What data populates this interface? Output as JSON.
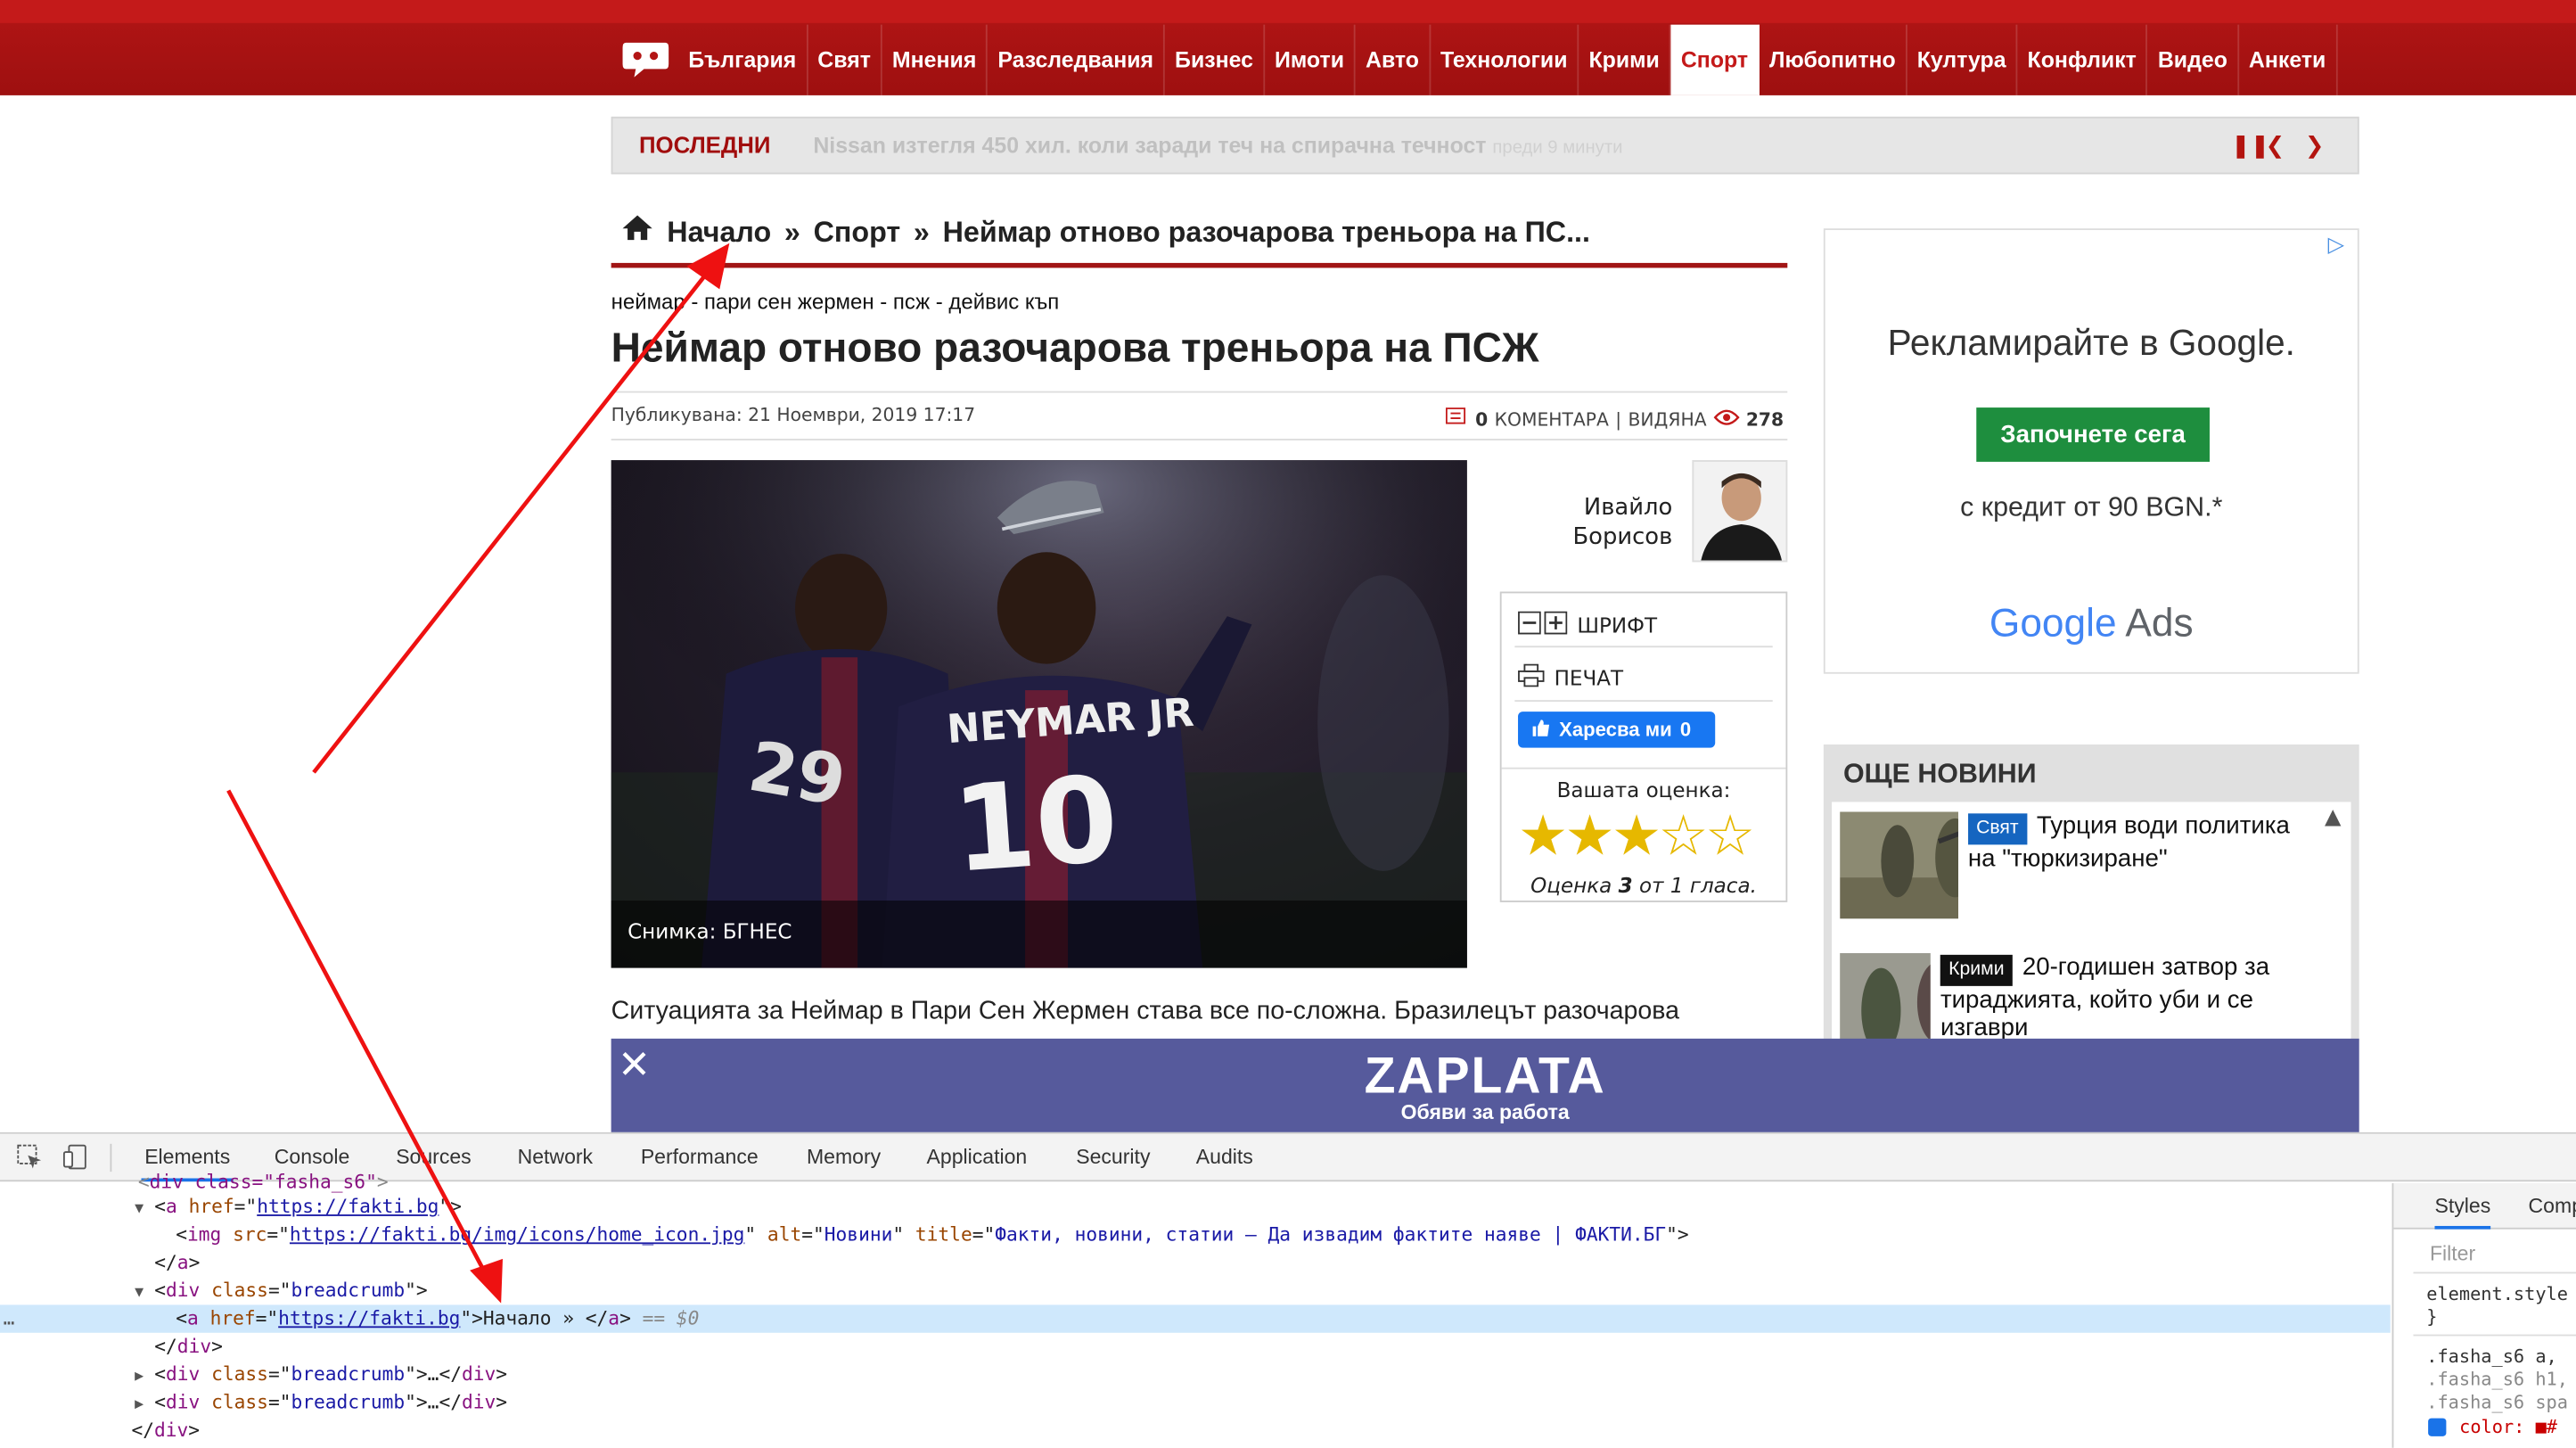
{
  "nav": {
    "items": [
      "България",
      "Свят",
      "Мнения",
      "Разследвания",
      "Бизнес",
      "Имоти",
      "Авто",
      "Технологии",
      "Крими",
      "Спорт",
      "Любопитно",
      "Култура",
      "Конфликт",
      "Видео",
      "Анкети"
    ],
    "active": "Спорт"
  },
  "ticker": {
    "label": "ПОСЛЕДНИ",
    "headline": "Nissan изтегля 450 хил. коли заради теч на спирачна течност",
    "time": "преди 9 минути"
  },
  "breadcrumb": {
    "home": "Начало",
    "sep1": "»",
    "section": "Спорт",
    "sep2": "»",
    "current": "Неймар отново разочарова треньора на ПС..."
  },
  "article": {
    "tags": "неймар - пари сен жермен - псж - дейвис къп",
    "title": "Неймар отново разочарова треньора на ПСЖ",
    "published": "Публикувана: 21 Ноември, 2019 17:17",
    "comments_count": "0",
    "comments_label": "КОМЕНТАРА",
    "views_label": "ВИДЯНА",
    "views_count": "278",
    "photo_caption": "Снимка: БГНЕС",
    "jersey_name": "NEYMAR JR",
    "jersey_number": "10",
    "lead": "Ситуацията за Неймар в Пари Сен Жермен става все по-сложна. Бразилецът разочарова"
  },
  "author": {
    "first": "Ивайло",
    "last": "Борисов"
  },
  "tools": {
    "font": "ШРИФТ",
    "print": "ПЕЧАТ",
    "like": "Харесва ми",
    "like_count": "0",
    "rating_label": "Вашата оценка:",
    "stars": "★★★☆☆",
    "rating_prefix": "Оценка",
    "rating_value": "3",
    "rating_mid": "от",
    "rating_votes": "1",
    "rating_suffix": "гласа."
  },
  "ad": {
    "title": "Рекламирайте в Google.",
    "button": "Започнете сега",
    "sub": "с кредит от 90 BGN.*",
    "logo_google": "Google",
    "logo_ads": "Ads"
  },
  "more_news": {
    "title": "ОЩЕ НОВИНИ",
    "items": [
      {
        "category": "Свят",
        "cat_color": "#1565c0",
        "text": "Турция води политика на \"тюркизиране\""
      },
      {
        "category": "Крими",
        "cat_color": "#111111",
        "text": "20-годишен затвор за тираджията, който уби и се изгаври"
      }
    ]
  },
  "banner": {
    "logo": "ZAPLATA",
    "sub": "Обяви за работа"
  },
  "devtools": {
    "tabs": [
      "Elements",
      "Console",
      "Sources",
      "Network",
      "Performance",
      "Memory",
      "Application",
      "Security",
      "Audits"
    ],
    "active_tab": "Elements",
    "styles_tabs": [
      "Styles",
      "Comp"
    ],
    "filter_placeholder": "Filter",
    "code": {
      "l0": "div class=\"fasha_s6\"",
      "a_href": "https://fakti.bg",
      "img_src": "https://fakti.bg/img/icons/home_icon.jpg",
      "img_alt": "Новини",
      "img_title": "Факти, новини, статии – Да извадим фактите наяве | ФАКТИ.БГ",
      "div_class": "breadcrumb",
      "sel_text": "Начало » ",
      "sel_marker": "== $0",
      "ellipsis": "…"
    },
    "styles_lines": [
      "element.style",
      "}",
      ".fasha_s6 a,",
      ".fasha_s6 h1,",
      ".fasha_s6 spa",
      "color: ■#"
    ]
  }
}
